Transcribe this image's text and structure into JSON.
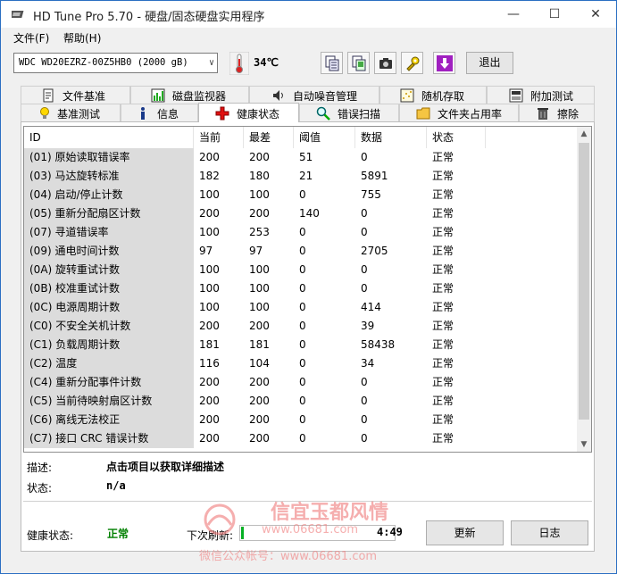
{
  "window": {
    "title": "HD Tune Pro 5.70 - 硬盘/固态硬盘实用程序",
    "minimize": "—",
    "maximize": "☐",
    "close": "✕"
  },
  "menu": {
    "file": "文件(F)",
    "help": "帮助(H)"
  },
  "toolbar": {
    "drive": "WDC WD20EZRZ-00Z5HB0 (2000 gB)",
    "temperature": "34℃",
    "exit_label": "退出",
    "icons": [
      "copy-text-icon",
      "copy-screen-icon",
      "camera-icon",
      "settings-tools-icon",
      "save-download-icon"
    ]
  },
  "tabs_row1": [
    {
      "label": "文件基准",
      "icon": "file-benchmark-icon"
    },
    {
      "label": "磁盘监视器",
      "icon": "disk-monitor-icon"
    },
    {
      "label": "自动噪音管理",
      "icon": "speaker-icon"
    },
    {
      "label": "随机存取",
      "icon": "random-access-icon"
    },
    {
      "label": "附加测试",
      "icon": "extra-tests-icon"
    }
  ],
  "tabs_row2": [
    {
      "label": "基准测试",
      "icon": "benchmark-icon"
    },
    {
      "label": "信息",
      "icon": "info-icon"
    },
    {
      "label": "健康状态",
      "icon": "health-icon"
    },
    {
      "label": "错误扫描",
      "icon": "error-scan-icon"
    },
    {
      "label": "文件夹占用率",
      "icon": "folder-usage-icon"
    },
    {
      "label": "擦除",
      "icon": "erase-icon"
    }
  ],
  "active_tab": "健康状态",
  "table": {
    "columns": [
      "ID",
      "当前",
      "最差",
      "阈值",
      "数据",
      "状态"
    ],
    "rows": [
      [
        "(01) 原始读取错误率",
        "200",
        "200",
        "51",
        "0",
        "正常"
      ],
      [
        "(03) 马达旋转标准",
        "182",
        "180",
        "21",
        "5891",
        "正常"
      ],
      [
        "(04) 启动/停止计数",
        "100",
        "100",
        "0",
        "755",
        "正常"
      ],
      [
        "(05) 重新分配扇区计数",
        "200",
        "200",
        "140",
        "0",
        "正常"
      ],
      [
        "(07) 寻道错误率",
        "100",
        "253",
        "0",
        "0",
        "正常"
      ],
      [
        "(09) 通电时间计数",
        "97",
        "97",
        "0",
        "2705",
        "正常"
      ],
      [
        "(0A) 旋转重试计数",
        "100",
        "100",
        "0",
        "0",
        "正常"
      ],
      [
        "(0B) 校准重试计数",
        "100",
        "100",
        "0",
        "0",
        "正常"
      ],
      [
        "(0C) 电源周期计数",
        "100",
        "100",
        "0",
        "414",
        "正常"
      ],
      [
        "(C0) 不安全关机计数",
        "200",
        "200",
        "0",
        "39",
        "正常"
      ],
      [
        "(C1) 负载周期计数",
        "181",
        "181",
        "0",
        "58438",
        "正常"
      ],
      [
        "(C2) 温度",
        "116",
        "104",
        "0",
        "34",
        "正常"
      ],
      [
        "(C4) 重新分配事件计数",
        "200",
        "200",
        "0",
        "0",
        "正常"
      ],
      [
        "(C5) 当前待映射扇区计数",
        "200",
        "200",
        "0",
        "0",
        "正常"
      ],
      [
        "(C6) 离线无法校正",
        "200",
        "200",
        "0",
        "0",
        "正常"
      ],
      [
        "(C7) 接口 CRC 错误计数",
        "200",
        "200",
        "0",
        "0",
        "正常"
      ]
    ]
  },
  "description": {
    "desc_label": "描述:",
    "desc_value": "点击项目以获取详细描述",
    "status_label": "状态:",
    "status_value": "n/a"
  },
  "bottom": {
    "health_label": "健康状态:",
    "health_value": "正常",
    "next_refresh_label": "下次刷新:",
    "next_refresh_time": "4:49",
    "next_refresh_progress": 0.02,
    "refresh_button": "更新",
    "log_button": "日志"
  },
  "watermark": {
    "line1": "信宜玉都风情",
    "line2": "www.06681.com",
    "line3": "微信公众帐号：www.06681.com"
  }
}
